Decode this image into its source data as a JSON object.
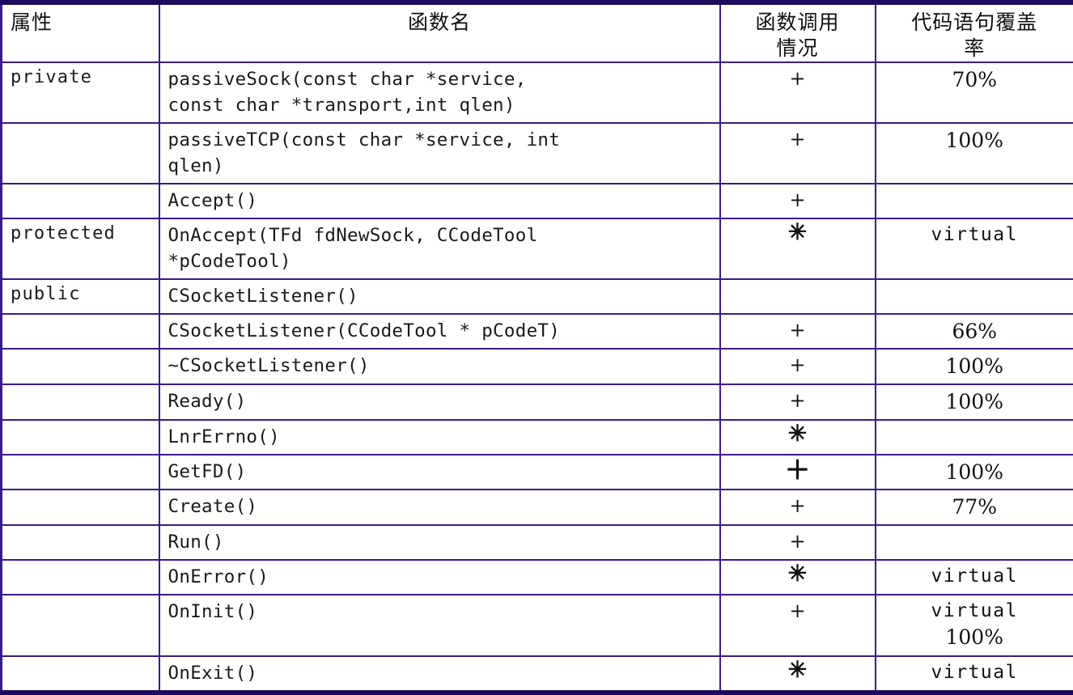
{
  "table": {
    "headers": [
      {
        "label": "属性",
        "align": "left"
      },
      {
        "label": "函数名",
        "align": "center"
      },
      {
        "label": "函数调用\n情况",
        "align": "center"
      },
      {
        "label": "代码语句覆盖\n率",
        "align": "center"
      }
    ],
    "border_color": "#3a1a8f",
    "outer_border_color": "#1d0a5e",
    "background_color": "#fffffd",
    "text_color": "#111111",
    "rows": [
      {
        "attribute": "private",
        "function": "passiveSock(const char *service,\nconst char *transport,int qlen)",
        "call_status": "+",
        "coverage": "70%",
        "coverage_kind": "percent",
        "height": "two-line"
      },
      {
        "attribute": "",
        "function": "passiveTCP(const char *service, int\nqlen)",
        "call_status": "+",
        "coverage": "100%",
        "coverage_kind": "percent",
        "height": "two-line"
      },
      {
        "attribute": "",
        "function": "Accept()",
        "call_status": "+",
        "coverage": "",
        "coverage_kind": "none",
        "height": "one-line"
      },
      {
        "attribute": "protected",
        "function": "OnAccept(TFd fdNewSock, CCodeTool\n*pCodeTool)",
        "call_status": "✳",
        "coverage": "virtual",
        "coverage_kind": "keyword",
        "height": "two-line"
      },
      {
        "attribute": "public",
        "function": "CSocketListener()",
        "call_status": "",
        "coverage": "",
        "coverage_kind": "none",
        "height": "one-line"
      },
      {
        "attribute": "",
        "function": "CSocketListener(CCodeTool * pCodeT)",
        "call_status": "+",
        "coverage": "66%",
        "coverage_kind": "percent",
        "height": "one-line"
      },
      {
        "attribute": "",
        "function": "~CSocketListener()",
        "call_status": "+",
        "coverage": "100%",
        "coverage_kind": "percent",
        "height": "one-line"
      },
      {
        "attribute": "",
        "function": "Ready()",
        "call_status": "+",
        "coverage": "100%",
        "coverage_kind": "percent",
        "height": "one-line"
      },
      {
        "attribute": "",
        "function": "LnrErrno()",
        "call_status": "✳",
        "coverage": "",
        "coverage_kind": "none",
        "height": "one-line"
      },
      {
        "attribute": "",
        "function": "GetFD()",
        "call_status": "＋",
        "coverage": "100%",
        "coverage_kind": "percent",
        "height": "one-line"
      },
      {
        "attribute": "",
        "function": "Create()",
        "call_status": "+",
        "coverage": "77%",
        "coverage_kind": "percent",
        "height": "one-line"
      },
      {
        "attribute": "",
        "function": "Run()",
        "call_status": "+",
        "coverage": "",
        "coverage_kind": "none",
        "height": "one-line"
      },
      {
        "attribute": "",
        "function": "OnError()",
        "call_status": "✳",
        "coverage": "virtual",
        "coverage_kind": "keyword",
        "height": "one-line"
      },
      {
        "attribute": "",
        "function": "OnInit()",
        "call_status": "+",
        "coverage": "virtual",
        "coverage_extra": "100%",
        "coverage_kind": "keyword-percent",
        "height": "tall"
      },
      {
        "attribute": "",
        "function": "OnExit()",
        "call_status": "✳",
        "coverage": "virtual",
        "coverage_kind": "keyword",
        "height": "one-line"
      }
    ]
  }
}
